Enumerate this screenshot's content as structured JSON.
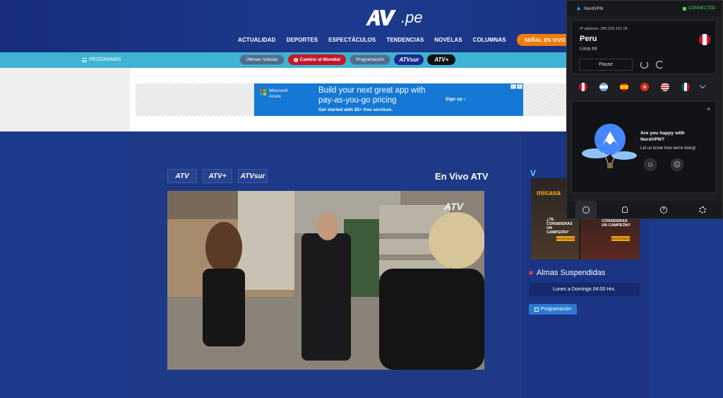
{
  "site": {
    "logo_text": "ATV",
    "logo_suffix": ".pe",
    "nav": [
      "ACTUALIDAD",
      "DEPORTES",
      "ESPECTÁCULOS",
      "TENDENCIAS",
      "NOVELAS",
      "COLUMNAS"
    ],
    "live_button": "SEÑAL EN VIVO",
    "programs_menu": "PROGRAMAS",
    "sub_pills": {
      "latest_news": "Últimas noticias",
      "world_cup": "Camino al Mundial",
      "schedule": "Programación",
      "atv_sur": "ATVsur",
      "atv_plus": "ATV+"
    }
  },
  "ad": {
    "brand_line1": "Microsoft",
    "brand_line2": "Azure",
    "headline": "Build your next great app with pay-as-you-go pricing",
    "sub": "Get started with $5+ free services.",
    "cta": "Sign up ›"
  },
  "player": {
    "channels": [
      "ATV",
      "ATV+",
      "ATVsur"
    ],
    "title": "En Vivo ATV",
    "watermark": "ATV"
  },
  "sidebar": {
    "banner_brand": "micasa",
    "banner_text1": "¿TE CONSIDERAS UN CAMPEÓN?",
    "banner_text2": "¿TE CONSIDERAS UN CAMPEÓN?",
    "banner_btn": "REGÍSTRATE",
    "show_title": "Almas Suspendidas",
    "schedule": "Lunes a Domingo 04:00 Hrs.",
    "program_button": "Programación"
  },
  "vpn": {
    "brand": "NordVPN",
    "status": "CONNECTED",
    "ip": "IP address: 185.239.151.18",
    "country": "Peru",
    "server": "Lima #4",
    "pause": "Pause",
    "happy_question": "Are you happy with NordVPN?",
    "happy_sub": "Let us know how we're doing!",
    "close": "×",
    "colors": {
      "accent": "#4687ff",
      "connected": "#4cd964"
    }
  }
}
